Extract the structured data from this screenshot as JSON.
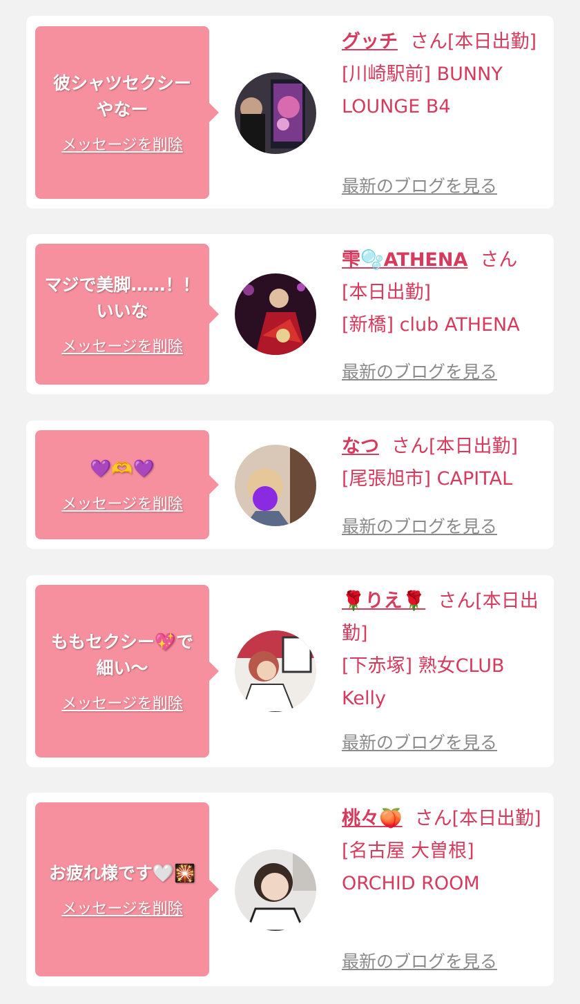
{
  "colors": {
    "background": "#f2f2f2",
    "card": "#ffffff",
    "bubble": "#f7909e",
    "accent": "#d63a5c",
    "link_gray": "#8a8a8a"
  },
  "common": {
    "delete_label": "メッセージを削除",
    "blog_label": "最新のブログを見る"
  },
  "items": [
    {
      "message": "彼シャツセクシーやなー",
      "name": "グッチ",
      "status": "さん[本日出勤]",
      "shop": "[川崎駅前] BUNNY LOUNGE B4",
      "avatar_icon": "avatar-photo"
    },
    {
      "message": "マジで美脚……！！いいな",
      "name": "雫🫧ATHENA",
      "status": "さん[本日出勤]",
      "shop": "[新橋] club ATHENA",
      "avatar_icon": "avatar-photo"
    },
    {
      "message": "💜🫶💜",
      "name": "なつ",
      "status": "さん[本日出勤]",
      "shop": "[尾張旭市] CAPITAL",
      "avatar_icon": "avatar-photo"
    },
    {
      "message": "ももセクシー💖で細い〜",
      "name": "🌹りえ🌹",
      "status": "さん[本日出勤]",
      "shop": "[下赤塚] 熟女CLUB Kelly",
      "avatar_icon": "avatar-photo"
    },
    {
      "message": "お疲れ様です🤍🎇",
      "name": "桃々🍑",
      "status": "さん[本日出勤]",
      "shop": "[名古屋 大曽根] ORCHID ROOM",
      "avatar_icon": "avatar-photo"
    }
  ]
}
